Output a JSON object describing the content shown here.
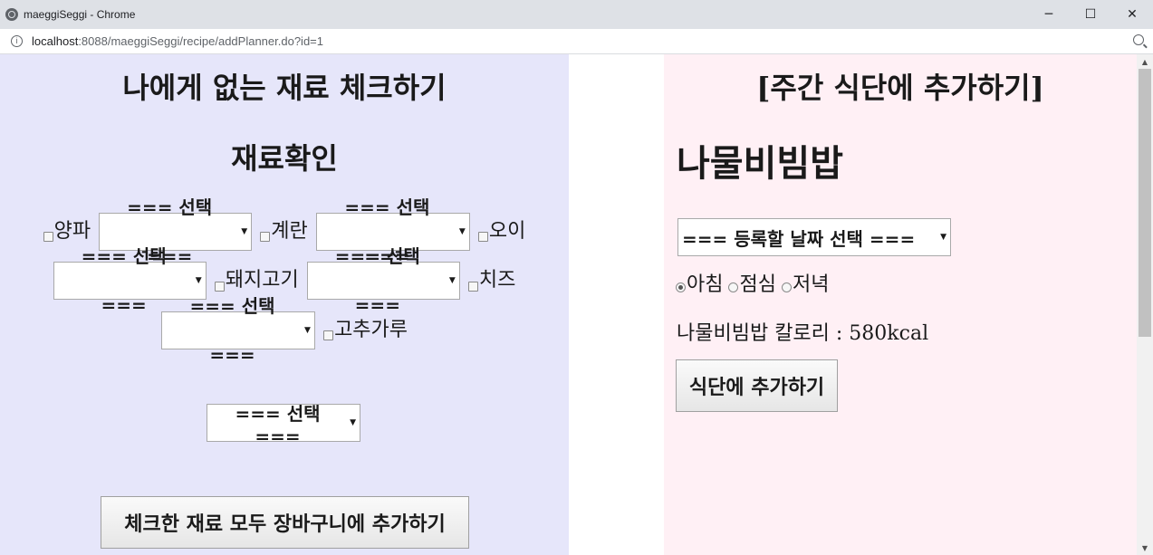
{
  "window": {
    "title": "maeggiSeggi - Chrome",
    "controls": {
      "minimize": "─",
      "maximize": "☐",
      "close": "✕"
    }
  },
  "address_bar": {
    "url_host": "localhost",
    "url_rest": ":8088/maeggiSeggi/recipe/addPlanner.do?id=1"
  },
  "left": {
    "title": "나에게 없는 재료 체크하기",
    "subtitle": "재료확인",
    "ingredients": [
      {
        "label": "양파",
        "select": "=== 선택 ==="
      },
      {
        "label": "계란",
        "select": "=== 선택 ==="
      },
      {
        "label": "오이",
        "select": "=== 선택 ==="
      },
      {
        "label": "돼지고기",
        "select": "=== 선택 ==="
      },
      {
        "label": "치즈",
        "select": "=== 선택 ==="
      },
      {
        "label": "고추가루"
      }
    ],
    "extra_select": "=== 선택 ===",
    "cart_button": "체크한 재료 모두 장바구니에 추가하기"
  },
  "right": {
    "title": "[주간 식단에 추가하기]",
    "recipe_name": "나물비빔밥",
    "date_select": "=== 등록할 날짜 선택 ===",
    "meals": [
      {
        "label": "아침",
        "selected": true
      },
      {
        "label": "점심",
        "selected": false
      },
      {
        "label": "저녁",
        "selected": false
      }
    ],
    "calorie_text": "나물비빔밥 칼로리 : 580kcal",
    "add_button": "식단에 추가하기"
  },
  "colors": {
    "left_bg": "#e6e6fa",
    "right_bg": "#fff0f5"
  }
}
